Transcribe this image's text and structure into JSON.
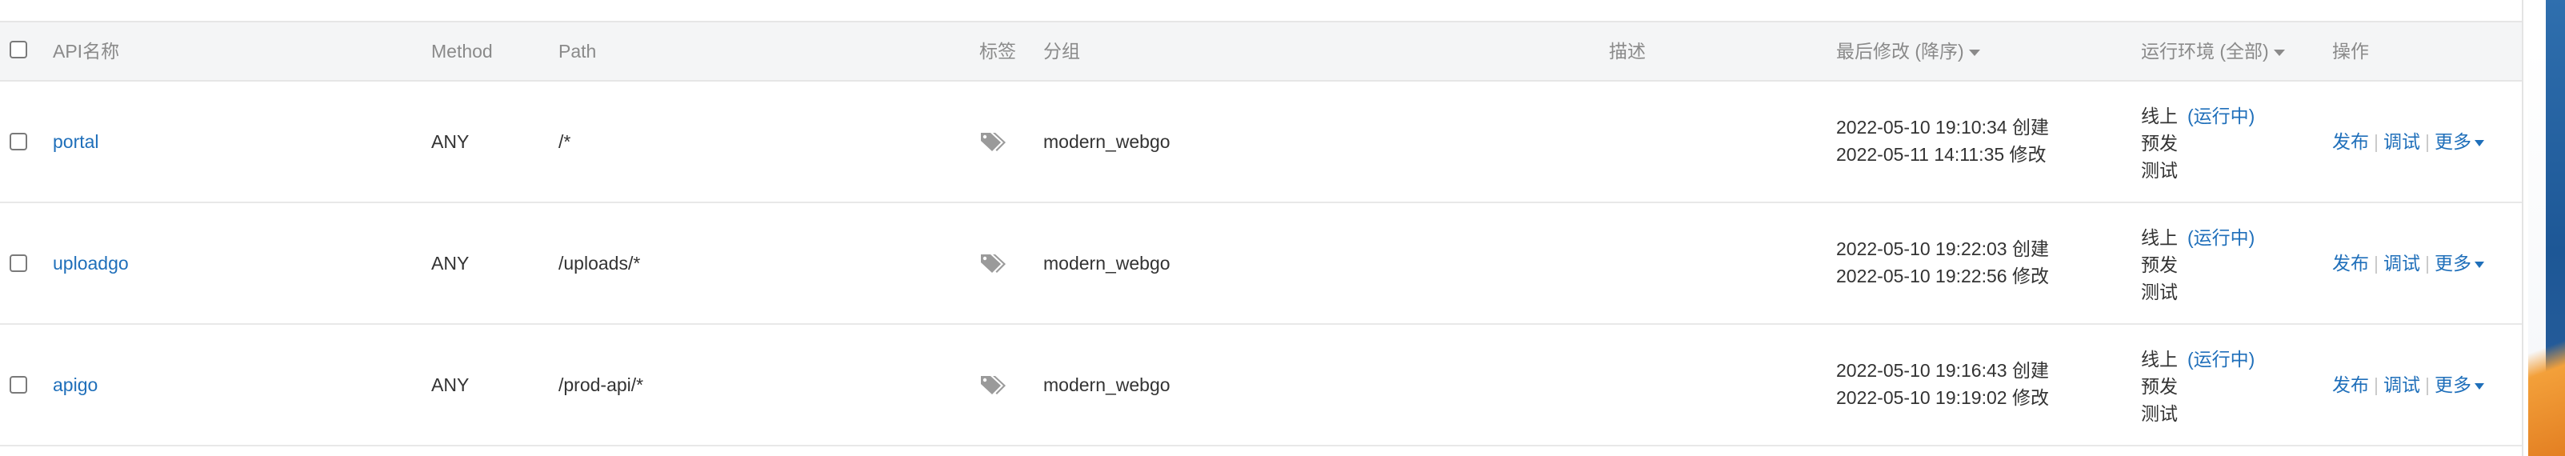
{
  "table": {
    "headers": {
      "name": "API名称",
      "method": "Method",
      "path": "Path",
      "tags": "标签",
      "group": "分组",
      "description": "描述",
      "last_modified": "最后修改 (降序)",
      "environment": "运行环境 (全部)",
      "actions": "操作"
    },
    "rows": [
      {
        "name": "portal",
        "method": "ANY",
        "path": "/*",
        "group": "modern_webgo",
        "created": "2022-05-10 19:10:34 创建",
        "modified": "2022-05-11 14:11:35 修改",
        "env_online": "线上",
        "env_online_status": "(运行中)",
        "env_pre": "预发",
        "env_test": "测试"
      },
      {
        "name": "uploadgo",
        "method": "ANY",
        "path": "/uploads/*",
        "group": "modern_webgo",
        "created": "2022-05-10 19:22:03 创建",
        "modified": "2022-05-10 19:22:56 修改",
        "env_online": "线上",
        "env_online_status": "(运行中)",
        "env_pre": "预发",
        "env_test": "测试"
      },
      {
        "name": "apigo",
        "method": "ANY",
        "path": "/prod-api/*",
        "group": "modern_webgo",
        "created": "2022-05-10 19:16:43 创建",
        "modified": "2022-05-10 19:19:02 修改",
        "env_online": "线上",
        "env_online_status": "(运行中)",
        "env_pre": "预发",
        "env_test": "测试"
      }
    ],
    "actions": {
      "publish": "发布",
      "debug": "调试",
      "more": "更多",
      "separator": "|"
    }
  },
  "icons": {
    "tag": "tag-icon",
    "sort_caret": "caret-down-icon"
  },
  "colors": {
    "link": "#1f6fba",
    "header_bg": "#f4f5f6",
    "header_text": "#8a8a8a",
    "text": "#333333"
  }
}
